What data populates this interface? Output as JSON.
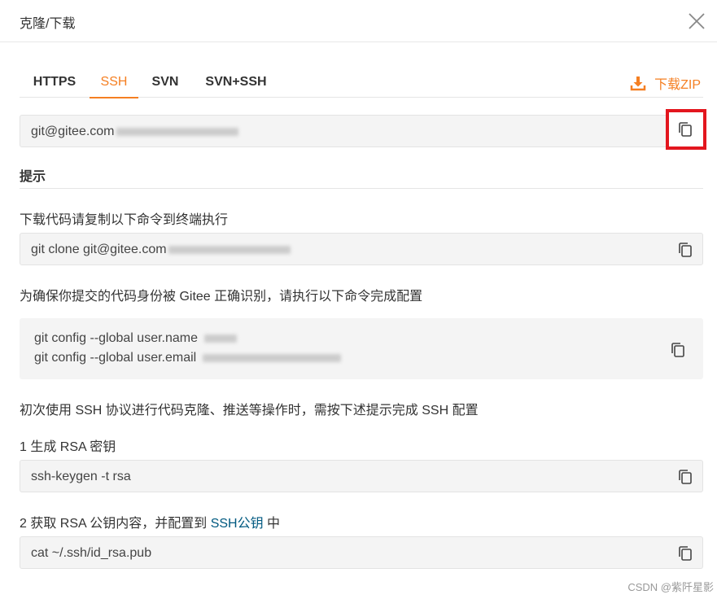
{
  "dialog": {
    "title": "克隆/下载"
  },
  "tabs": [
    {
      "label": "HTTPS"
    },
    {
      "label": "SSH"
    },
    {
      "label": "SVN"
    },
    {
      "label": "SVN+SSH"
    }
  ],
  "download_zip": "下载ZIP",
  "ssh_url": {
    "value": "git@gitee.com"
  },
  "tips": {
    "title": "提示",
    "clone_intro": "下载代码请复制以下命令到终端执行",
    "clone_command": "git clone git@gitee.com",
    "config_intro": "为确保你提交的代码身份被 Gitee 正确识别，请执行以下命令完成配置",
    "config_line1": "git config --global user.name",
    "config_line2": "git config --global user.email",
    "ssh_intro": "初次使用 SSH 协议进行代码克隆、推送等操作时，需按下述提示完成 SSH 配置",
    "step1_label": "1 生成 RSA 密钥",
    "step1_command": "ssh-keygen -t rsa",
    "step2_prefix": "2 获取 RSA 公钥内容，并配置到 ",
    "step2_link": "SSH公钥",
    "step2_suffix": " 中",
    "step2_command": "cat ~/.ssh/id_rsa.pub"
  },
  "watermark": "CSDN @紫阡星影",
  "colors": {
    "accent": "#f57f22",
    "highlight_border": "#e3161e",
    "link": "#005980"
  },
  "icons": {
    "close": "close-icon",
    "download": "download-icon",
    "copy": "copy-icon"
  }
}
